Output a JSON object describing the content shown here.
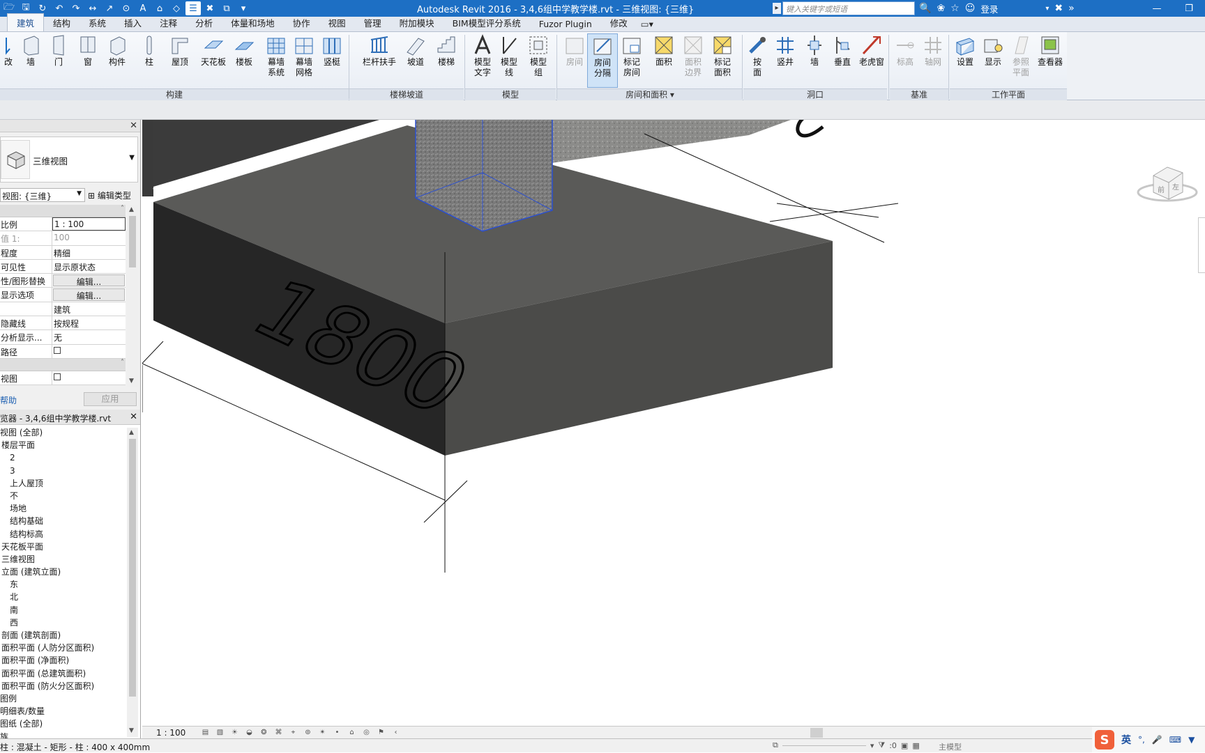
{
  "app": {
    "title": "Autodesk Revit 2016 -     3,4,6组中学教学楼.rvt - 三维视图: {三维}",
    "search_placeholder": "键入关键字或短语",
    "login_label": "登录"
  },
  "tabs": [
    {
      "label": "建筑",
      "active": true
    },
    {
      "label": "结构"
    },
    {
      "label": "系统"
    },
    {
      "label": "插入"
    },
    {
      "label": "注释"
    },
    {
      "label": "分析"
    },
    {
      "label": "体量和场地"
    },
    {
      "label": "协作"
    },
    {
      "label": "视图"
    },
    {
      "label": "管理"
    },
    {
      "label": "附加模块"
    },
    {
      "label": "BIM模型评分系统"
    },
    {
      "label": "Fuzor Plugin"
    },
    {
      "label": "修改"
    }
  ],
  "ribbon": {
    "panels": {
      "build": "构建",
      "circulation": "楼梯坡道",
      "model": "模型",
      "room_area": "房间和面积",
      "opening": "洞口",
      "datum": "基准",
      "workplane": "工作平面"
    },
    "buttons": {
      "modify": "改",
      "wall": "墙",
      "door": "门",
      "window": "窗",
      "component": "构件",
      "column": "柱",
      "roof": "屋顶",
      "ceiling": "天花板",
      "floor": "楼板",
      "curtain_system": "幕墙\n系统",
      "curtain_grid": "幕墙\n网格",
      "mullion": "竖梃",
      "railing": "栏杆扶手",
      "ramp": "坡道",
      "stair": "楼梯",
      "model_text": "模型\n文字",
      "model_line": "模型\n线",
      "model_group": "模型\n组",
      "room": "房间",
      "room_separator": "房间\n分隔",
      "tag_room": "标记\n房间",
      "area": "面积",
      "area_boundary": "面积\n边界",
      "tag_area": "标记\n面积",
      "by_face": "按\n面",
      "shaft": "竖井",
      "wall_opening": "墙",
      "vertical": "垂直",
      "dormer": "老虎窗",
      "level": "标高",
      "grid": "轴网",
      "set": "设置",
      "show": "显示",
      "ref_plane": "参照\n平面",
      "viewer": "查看器"
    }
  },
  "properties": {
    "type_name": "三维视图",
    "instance_selector": "视图: {三维}",
    "edit_type": "编辑类型",
    "rows": [
      {
        "k": "比例",
        "v": "1 : 100"
      },
      {
        "k": "值 1:",
        "v": "100"
      },
      {
        "k": "程度",
        "v": "精细"
      },
      {
        "k": "可见性",
        "v": "显示原状态"
      },
      {
        "k": "性/图形替换",
        "v": "编辑..."
      },
      {
        "k": "显示选项",
        "v": "编辑..."
      },
      {
        "k": "",
        "v": "建筑"
      },
      {
        "k": "隐藏线",
        "v": "按规程"
      },
      {
        "k": "分析显示...",
        "v": "无"
      },
      {
        "k": "路径",
        "v": ""
      }
    ],
    "row_after": {
      "k": "视图",
      "v": ""
    },
    "help": "帮助",
    "apply": "应用"
  },
  "browser": {
    "title": "览器 - 3,4,6组中学教学楼.rvt",
    "nodes": [
      "视图 (全部)",
      "楼层平面",
      "2",
      "3",
      "上人屋顶",
      "不",
      "场地",
      "结构基础",
      "结构标高",
      "天花板平面",
      "三维视图",
      "立面 (建筑立面)",
      "东",
      "北",
      "南",
      "西",
      "剖面 (建筑剖面)",
      "面积平面 (人防分区面积)",
      "面积平面 (净面积)",
      "面积平面 (总建筑面积)",
      "面积平面 (防火分区面积)",
      "图例",
      "明细表/数量",
      "图纸 (全部)",
      "族"
    ]
  },
  "viewport": {
    "dimension_text": "1800",
    "viewcube_face_left": "前",
    "viewcube_face_right": "左"
  },
  "viewbar": {
    "scale": "1 : 100"
  },
  "status": {
    "message": "柱 : 混凝土 - 矩形 - 柱 : 400 x 400mm",
    "count": ":0",
    "model": "主模型"
  },
  "ime": {
    "logo": "S",
    "lang": "英"
  },
  "colors": {
    "titlebar": "#1d6fc4",
    "block_top": "#5a5a58",
    "block_front": "#262626",
    "block_right": "#4b4b49",
    "selection_blue": "#2b4fd0"
  }
}
